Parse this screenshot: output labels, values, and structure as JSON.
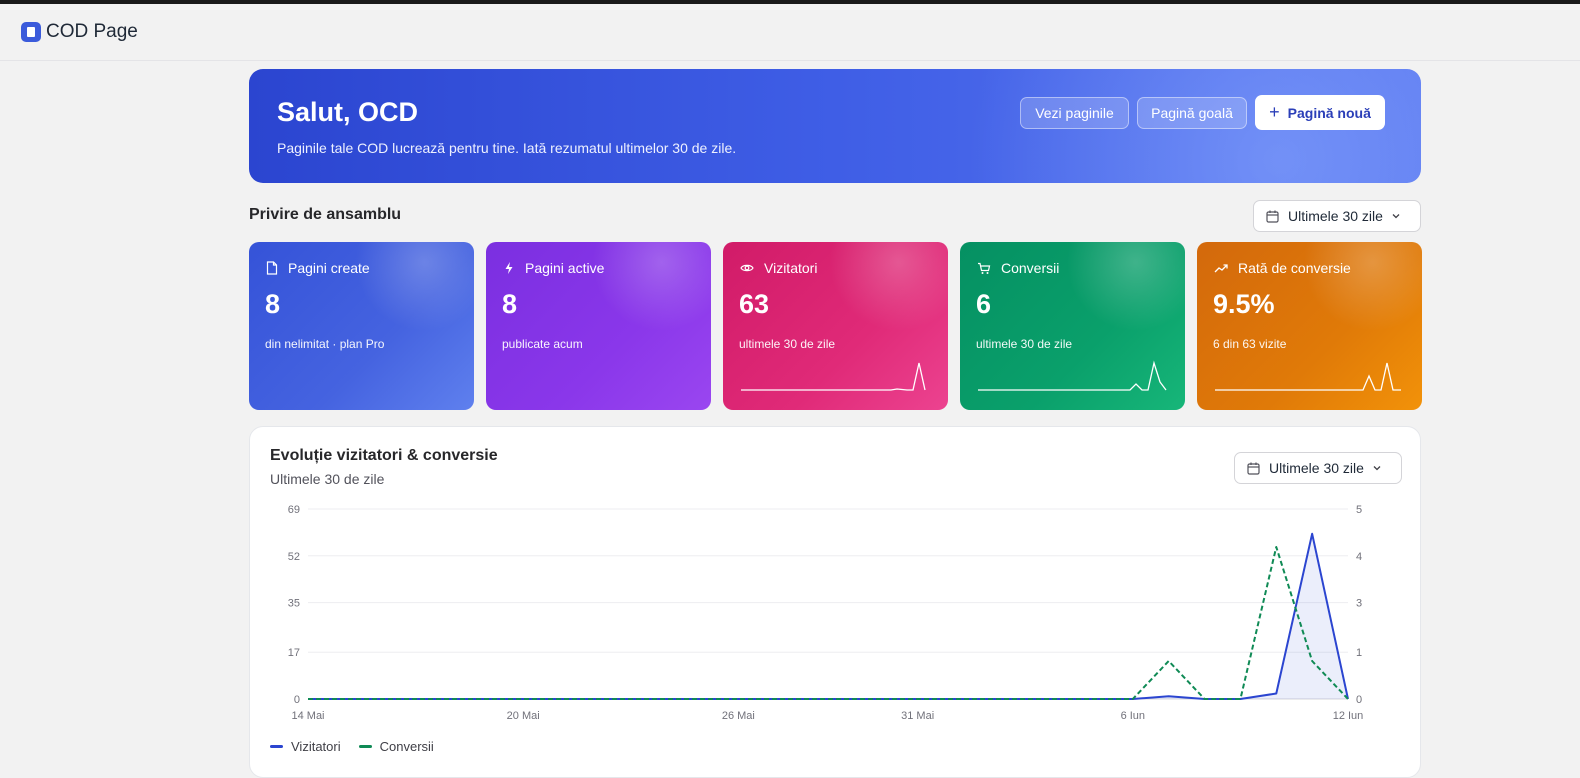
{
  "app": {
    "brand": "COD Page"
  },
  "hero": {
    "title": "Salut, OCD",
    "subtitle": "Paginile tale COD lucrează pentru tine. Iată rezumatul ultimelor 30 de zile.",
    "buttons": {
      "view_pages": "Vezi paginile",
      "blank_page": "Pagină goală",
      "new_page": "Pagină nouă"
    }
  },
  "overview": {
    "title": "Privire de ansamblu",
    "period": "Ultimele 30 zile",
    "cards": [
      {
        "label": "Pagini create",
        "value": "8",
        "sub": "din nelimitat · plan Pro",
        "icon": "file-icon"
      },
      {
        "label": "Pagini active",
        "value": "8",
        "sub": "publicate acum",
        "icon": "bolt-icon"
      },
      {
        "label": "Vizitatori",
        "value": "63",
        "sub": "ultimele 30 de zile",
        "icon": "eye-icon"
      },
      {
        "label": "Conversii",
        "value": "6",
        "sub": "ultimele 30 de zile",
        "icon": "cart-icon"
      },
      {
        "label": "Rată de conversie",
        "value": "9.5%",
        "sub": "6 din 63 vizite",
        "icon": "trending-up-icon"
      }
    ],
    "colors": {
      "pages_created": "#3553d8",
      "pages_active": "#7b2fe0",
      "visitors": "#d11b68",
      "conversions": "#059062",
      "rate": "#d3690c"
    }
  },
  "evolution": {
    "title": "Evoluție vizitatori & conversie",
    "subtitle": "Ultimele 30 de zile",
    "period": "Ultimele 30 zile"
  },
  "chart_data": {
    "type": "line",
    "x": [
      "14 Mai",
      "15 Mai",
      "16 Mai",
      "17 Mai",
      "18 Mai",
      "19 Mai",
      "20 Mai",
      "21 Mai",
      "22 Mai",
      "23 Mai",
      "24 Mai",
      "25 Mai",
      "26 Mai",
      "27 Mai",
      "28 Mai",
      "29 Mai",
      "30 Mai",
      "31 Mai",
      "1 Iun",
      "2 Iun",
      "3 Iun",
      "4 Iun",
      "5 Iun",
      "6 Iun",
      "7 Iun",
      "8 Iun",
      "9 Iun",
      "10 Iun",
      "11 Iun",
      "12 Iun"
    ],
    "x_tick_labels": [
      "14 Mai",
      "20 Mai",
      "26 Mai",
      "31 Mai",
      "6 Iun",
      "12 Iun"
    ],
    "series": [
      {
        "name": "Vizitatori",
        "axis": "left",
        "color": "#2b45d0",
        "style": "solid",
        "fill": true,
        "values": [
          0,
          0,
          0,
          0,
          0,
          0,
          0,
          0,
          0,
          0,
          0,
          0,
          0,
          0,
          0,
          0,
          0,
          0,
          0,
          0,
          0,
          0,
          0,
          0,
          1,
          0,
          0,
          2,
          60,
          0
        ]
      },
      {
        "name": "Conversii",
        "axis": "right",
        "color": "#0f8a55",
        "style": "dashed",
        "values": [
          0,
          0,
          0,
          0,
          0,
          0,
          0,
          0,
          0,
          0,
          0,
          0,
          0,
          0,
          0,
          0,
          0,
          0,
          0,
          0,
          0,
          0,
          0,
          0,
          1,
          0,
          0,
          4,
          1,
          0
        ]
      }
    ],
    "y_left": {
      "ticks": [
        0,
        17,
        35,
        52,
        69
      ],
      "ylim": [
        0,
        69
      ]
    },
    "y_right": {
      "ticks": [
        0,
        1,
        3,
        4,
        5
      ],
      "ylim": [
        0,
        5
      ]
    },
    "grid": true,
    "legend": "bottom-left"
  }
}
